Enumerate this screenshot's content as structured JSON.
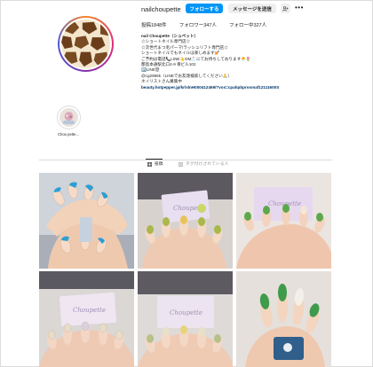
{
  "profile": {
    "username": "nailchoupette",
    "follow_label": "フォローする",
    "message_label": "メッセージを送信",
    "suggest_icon": "person-add-icon",
    "more_icon": "more-horizontal-icon",
    "stats": {
      "posts": "投稿1848件",
      "followers": "フォロワー347人",
      "following": "フォロー中327人"
    },
    "bio": {
      "name": "nail Choupette（シュペット）",
      "lines": [
        "☆ショートネイル専門店☆",
        "☆次世代まつ毛パーマ/ラッシュリフト専門店☆",
        "ショートネイルでもネイルは楽しめます💅",
        "ご予約は電話📞LINE👆DM📩にてお待ちしております🐣🌷",
        "都島本通駅北口4-9 幸ビル102",
        "🅿️LINE登",
        "@cg2866k（LINEでお友達検索してください🙏）",
        "ネイリストさん募集中"
      ],
      "link": "beauty.hotpepper.jp/kr/slnH000412469/?vos=cpahpbprosmaf12111600S"
    }
  },
  "highlights": [
    {
      "label": "Chou pette..."
    }
  ],
  "tabs": {
    "posts_label": "投稿",
    "tagged_label": "タグ付けされている人",
    "posts_icon": "grid-icon",
    "tagged_icon": "tagged-icon"
  },
  "posts": [
    {
      "name": "post-1",
      "nail": "#2b9fd6"
    },
    {
      "name": "post-2",
      "nail": "#a8b84a"
    },
    {
      "name": "post-3",
      "nail": "#5da84c"
    },
    {
      "name": "post-4",
      "nail": "#e6dcc8"
    },
    {
      "name": "post-5",
      "nail": "#e8e0c8"
    },
    {
      "name": "post-6",
      "nail": "#3f9b4c"
    }
  ]
}
